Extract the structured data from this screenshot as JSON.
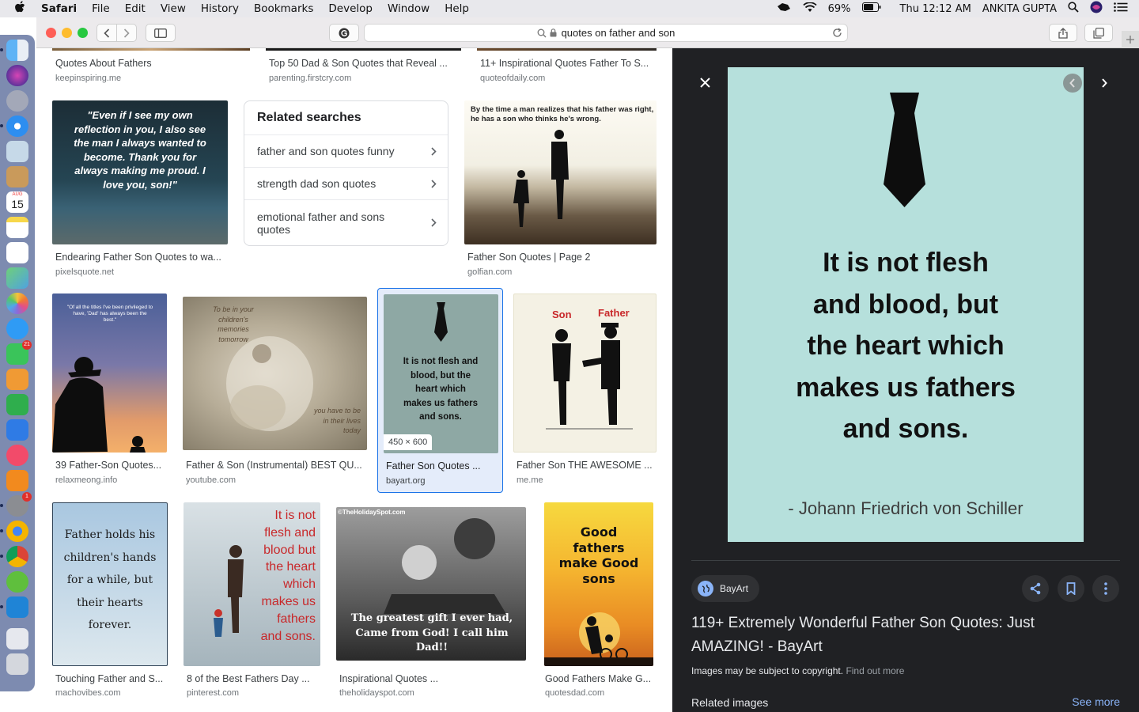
{
  "menubar": {
    "apple": "",
    "items": [
      "Safari",
      "File",
      "Edit",
      "View",
      "History",
      "Bookmarks",
      "Develop",
      "Window",
      "Help"
    ],
    "battery": "69%",
    "clock": "Thu 12:12 AM",
    "user": "ANKITA GUPTA"
  },
  "dock": {
    "calendar_day": "15",
    "calendar_month": "AUG",
    "badge_facetime": "21",
    "badge_prefs": "1"
  },
  "browser": {
    "address": "quotes on father and son",
    "reader_glyph": "C"
  },
  "results": {
    "top_row": [
      {
        "title": "Quotes About Fathers",
        "domain": "keepinspiring.me"
      },
      {
        "title": "Top 50 Dad & Son Quotes that Reveal ...",
        "domain": "parenting.firstcry.com"
      },
      {
        "title": "11+ Inspirational Quotes Father To S...",
        "domain": "quoteofdaily.com"
      }
    ],
    "row2": [
      {
        "title": "Endearing Father Son Quotes to wa...",
        "domain": "pixelsquote.net",
        "quote": "\"Even if I see my own reflection in you, I also see the man I always wanted to become. Thank you for always making me proud. I love you, son!\""
      },
      {
        "title": "Father Son Quotes | Page 2",
        "domain": "golfian.com",
        "quote": "By the time a man realizes that his father was right, he has a son who thinks he's wrong."
      }
    ],
    "related": {
      "heading": "Related searches",
      "items": [
        "father and son quotes funny",
        "strength dad son quotes",
        "emotional father and sons quotes"
      ]
    },
    "row3": [
      {
        "title": "39 Father-Son Quotes...",
        "domain": "relaxmeong.info",
        "quote": "\"Of all the titles I've been privileged to have, 'Dad' has always been the best.\""
      },
      {
        "title": "Father & Son (Instrumental) BEST QU...",
        "domain": "youtube.com",
        "quote_a": "To be in your children's memories tomorrow",
        "quote_b": "you have to be in their lives today"
      },
      {
        "title": "Father Son Quotes ...",
        "domain": "bayart.org",
        "quote": "It is not flesh and blood, but the heart which makes us fathers and sons.",
        "dims": "450 × 600"
      },
      {
        "title": "Father Son THE AWESOME ...",
        "domain": "me.me",
        "son": "Son",
        "father": "Father"
      }
    ],
    "row4": [
      {
        "title": "Touching Father and S...",
        "domain": "machovibes.com",
        "quote": "Father holds his children's hands for a while, but their hearts forever."
      },
      {
        "title": "8 of the Best Fathers Day ...",
        "domain": "pinterest.com",
        "quote": "It is not flesh and blood but the heart which makes us fathers and sons."
      },
      {
        "title": "Inspirational Quotes ...",
        "domain": "theholidayspot.com",
        "tag": "©TheHolidaySpot.com",
        "quote": "The greatest gift I ever had, Came from God! I call him Dad!!"
      },
      {
        "title": "Good Fathers Make G...",
        "domain": "quotesdad.com",
        "quote": "Good fathers make Good sons"
      }
    ]
  },
  "preview": {
    "quote_lines": [
      "It is not flesh",
      "and blood, but",
      "the heart which",
      "makes us fathers",
      "and sons."
    ],
    "author": "- Johann Friedrich von Schiller",
    "source": "BayArt",
    "title": "119+ Extremely Wonderful Father Son Quotes: Just AMAZING! - BayArt",
    "copyright": "Images may be subject to copyright.",
    "find_out_more": "Find out more",
    "related_images": "Related images",
    "see_more": "See more"
  },
  "colors": {
    "accent": "#8ab4f8",
    "panel_bg": "#202124",
    "preview_bg": "#b6e0dc",
    "selected_border": "#1a73e8"
  }
}
